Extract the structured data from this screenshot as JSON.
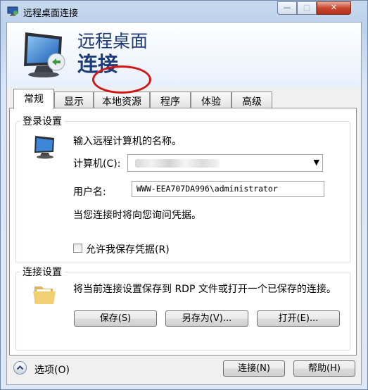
{
  "window": {
    "title": "远程桌面连接"
  },
  "title_buttons": {
    "minimize": "—",
    "maximize": "□",
    "close": "✕"
  },
  "banner": {
    "title": "远程桌面",
    "subtitle": "连接"
  },
  "tabs": [
    {
      "label": "常规",
      "active": true
    },
    {
      "label": "显示",
      "active": false
    },
    {
      "label": "本地资源",
      "active": false
    },
    {
      "label": "程序",
      "active": false
    },
    {
      "label": "体验",
      "active": false
    },
    {
      "label": "高级",
      "active": false
    }
  ],
  "login": {
    "legend": "登录设置",
    "prompt": "输入远程计算机的名称。",
    "computer_label": "计算机(C):",
    "username_label": "用户名:",
    "username_value": "WWW-EEA707DA996\\administrator",
    "credentials_note": "当您连接时将向您询问凭据。",
    "save_credentials_label": "允许我保存凭据(R)",
    "save_credentials_checked": false
  },
  "connection": {
    "legend": "连接设置",
    "description": "将当前连接设置保存到 RDP 文件或打开一个已保存的连接。",
    "save_label": "保存(S)",
    "saveas_label": "另存为(V)...",
    "open_label": "打开(E)..."
  },
  "footer": {
    "options_label": "选项(O)",
    "connect_label": "连接(N)",
    "help_label": "帮助(H)"
  },
  "colors": {
    "accent": "#1e3b7a",
    "annotation": "#d11616"
  }
}
